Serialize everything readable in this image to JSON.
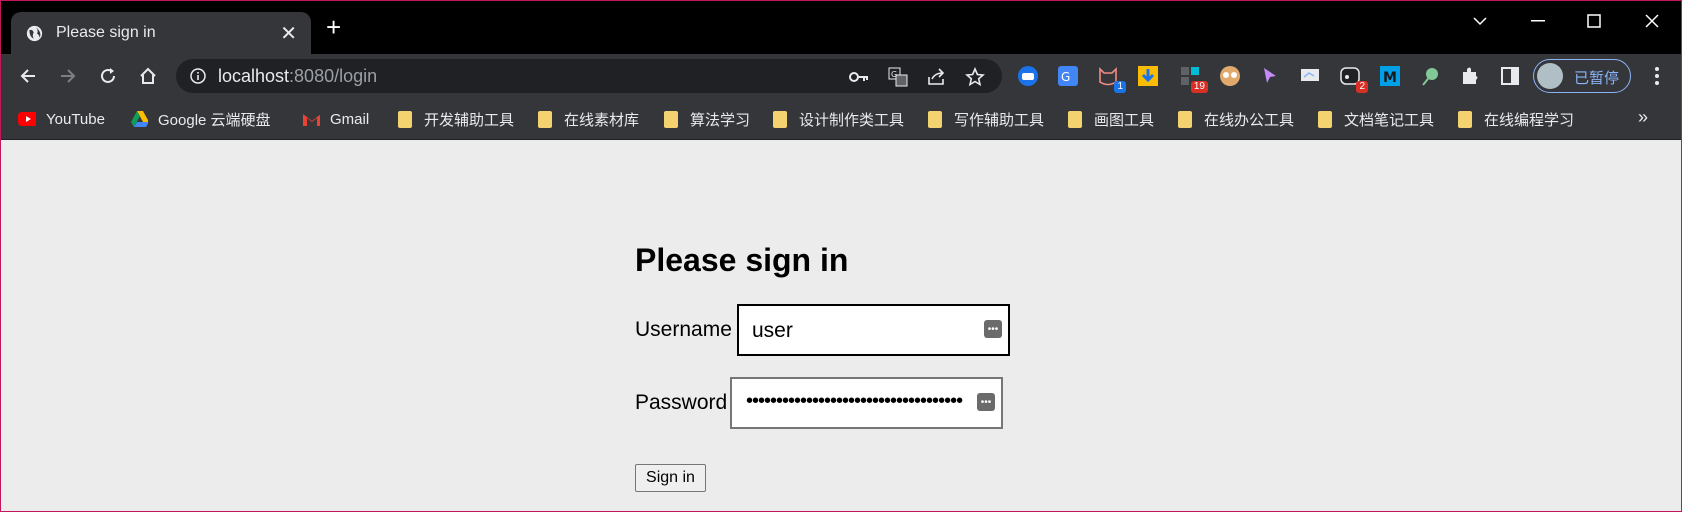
{
  "browser": {
    "tab_title": "Please sign in",
    "url_host": "localhost",
    "url_rest": ":8080/login",
    "profile_label": "已暂停",
    "extension_badges": {
      "ext3": "1",
      "ext6": "19",
      "ext12": "2"
    }
  },
  "bookmarks": [
    {
      "label": "YouTube",
      "icon": "youtube-icon"
    },
    {
      "label": "Google 云端硬盘",
      "icon": "google-drive-icon"
    },
    {
      "label": "Gmail",
      "icon": "gmail-icon"
    },
    {
      "label": "开发辅助工具",
      "icon": "folder-icon"
    },
    {
      "label": "在线素材库",
      "icon": "folder-icon"
    },
    {
      "label": "算法学习",
      "icon": "folder-icon"
    },
    {
      "label": "设计制作类工具",
      "icon": "folder-icon"
    },
    {
      "label": "写作辅助工具",
      "icon": "folder-icon"
    },
    {
      "label": "画图工具",
      "icon": "folder-icon"
    },
    {
      "label": "在线办公工具",
      "icon": "folder-icon"
    },
    {
      "label": "文档笔记工具",
      "icon": "folder-icon"
    },
    {
      "label": "在线编程学习",
      "icon": "folder-icon"
    }
  ],
  "login": {
    "heading": "Please sign in",
    "username_label": "Username",
    "username_value": "user",
    "password_label": "Password",
    "password_mask": "••••••••••••••••••••••••••••••••••••",
    "submit_label": "Sign in"
  },
  "colors": {
    "accent": "#8ab4f8",
    "chrome_bg": "#35363a",
    "page_bg": "#ececec"
  }
}
